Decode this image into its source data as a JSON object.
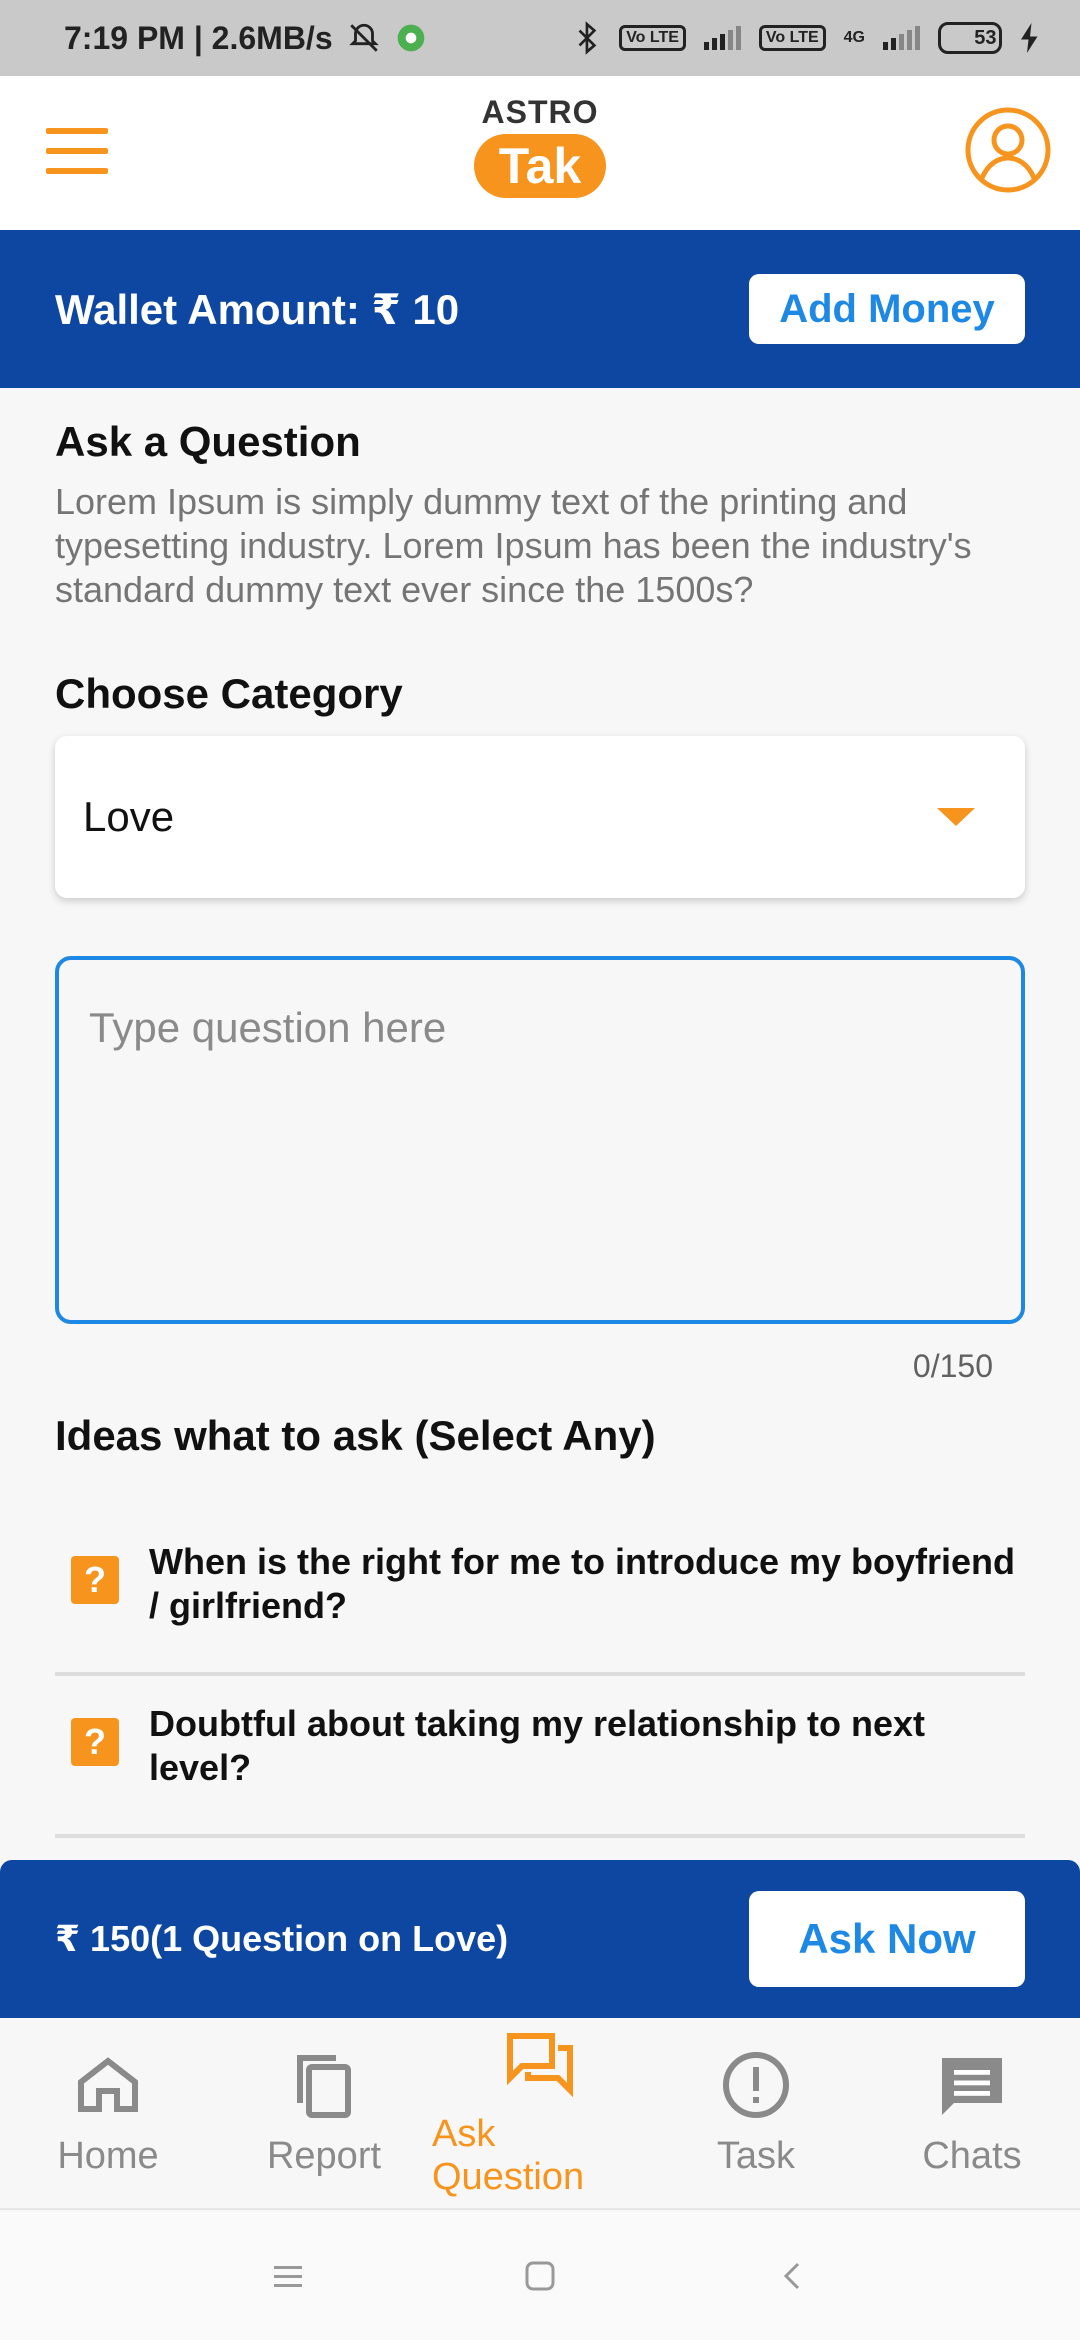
{
  "status_bar": {
    "time": "7:19 PM | 2.6MB/s",
    "net_left": "Vo LTE",
    "net_right_type": "4G",
    "net_right": "Vo LTE",
    "battery": "53",
    "battery_level": 0.53
  },
  "header": {
    "logo_top": "ASTRO",
    "logo_bottom": "Tak"
  },
  "wallet": {
    "label": "Wallet Amount: ₹ 10",
    "add_money": "Add Money"
  },
  "ask": {
    "title": "Ask a Question",
    "description": "Lorem Ipsum is simply dummy text of the printing and typesetting industry. Lorem Ipsum has been the industry's standard dummy text ever since the 1500s?",
    "category_heading": "Choose Category",
    "category_value": "Love",
    "question_placeholder": "Type question here",
    "counter": "0/150",
    "ideas_heading": "Ideas what to ask (Select Any)",
    "ideas": [
      {
        "icon": "?",
        "text": "When is the right for me to introduce my boyfriend / girlfriend?"
      },
      {
        "icon": "?",
        "text": "Doubtful about taking my relationship to next level?"
      }
    ]
  },
  "ask_bar": {
    "price": "₹ 150(1 Question on Love)",
    "ask_now": "Ask Now"
  },
  "bottom_nav": [
    {
      "label": "Home",
      "icon": "home-icon"
    },
    {
      "label": "Report",
      "icon": "report-icon"
    },
    {
      "label": "Ask Question",
      "icon": "chat-bubbles-icon",
      "active": true
    },
    {
      "label": "Task",
      "icon": "alert-icon"
    },
    {
      "label": "Chats",
      "icon": "message-icon"
    }
  ],
  "colors": {
    "brand_orange": "#f7941d",
    "brand_blue": "#0e47a1",
    "accent_blue": "#1e88e5"
  }
}
